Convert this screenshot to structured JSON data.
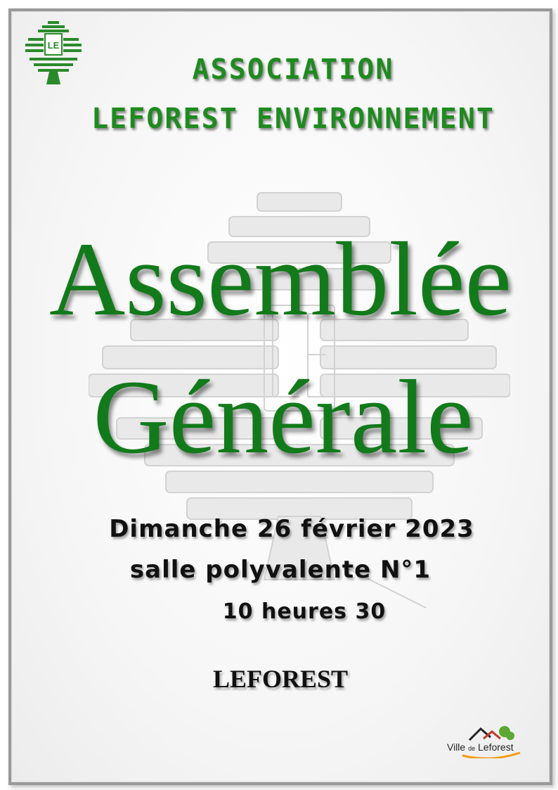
{
  "association": {
    "line1": "ASSOCIATION",
    "line2": "LEFOREST ENVIRONNEMENT"
  },
  "logo": {
    "icon": "tree-logo-icon",
    "letter": "LE",
    "color": "#1f8a1f"
  },
  "title": {
    "line1": "Assemblée",
    "line2": "Générale"
  },
  "event": {
    "date": "Dimanche 26 février 2023",
    "venue": "salle polyvalente N°1",
    "time": "10 heures 30",
    "place": "LEFOREST"
  },
  "ville_logo": {
    "prefix": "Ville",
    "middle": "de",
    "name": "Leforest"
  },
  "colors": {
    "green": "#127a1a",
    "text": "#111111"
  }
}
